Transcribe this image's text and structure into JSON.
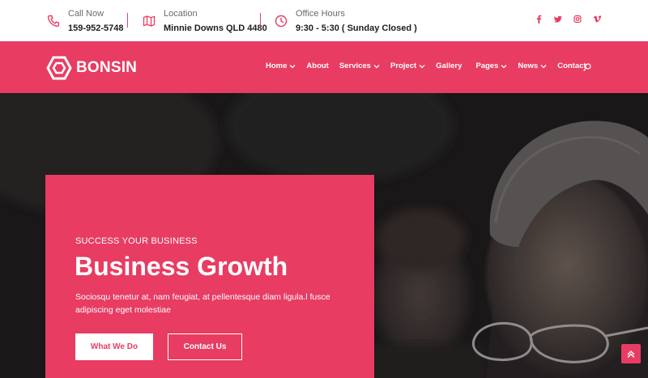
{
  "topbar": {
    "call": {
      "label": "Call Now",
      "value": "159-952-5748",
      "icon": "phone-icon"
    },
    "location": {
      "label": "Location",
      "value": "Minnie Downs QLD 4480",
      "icon": "map-icon"
    },
    "hours": {
      "label": "Office Hours",
      "value": "9:30 - 5:30 ( Sunday Closed )",
      "icon": "clock-icon"
    },
    "social": [
      "facebook-icon",
      "twitter-icon",
      "instagram-icon",
      "vimeo-icon"
    ]
  },
  "nav": {
    "brand": "BONSIN",
    "items": [
      {
        "label": "Home",
        "dropdown": true
      },
      {
        "label": "About",
        "dropdown": false
      },
      {
        "label": "Services",
        "dropdown": true
      },
      {
        "label": "Project",
        "dropdown": true
      },
      {
        "label": "Gallery",
        "dropdown": false
      },
      {
        "label": "Pages",
        "dropdown": true
      },
      {
        "label": "News",
        "dropdown": true
      },
      {
        "label": "Contact",
        "dropdown": false
      }
    ]
  },
  "hero": {
    "kicker": "SUCCESS YOUR BUSINESS",
    "title": "Business Growth",
    "description": "Sociosqu tenetur at, nam feugiat, at pellentesque diam ligula.l fusce adipiscing eget molestiae",
    "primary_button": "What We Do",
    "secondary_button": "Contact Us"
  },
  "colors": {
    "accent": "#e83c62",
    "dark": "#1d1d1d"
  }
}
